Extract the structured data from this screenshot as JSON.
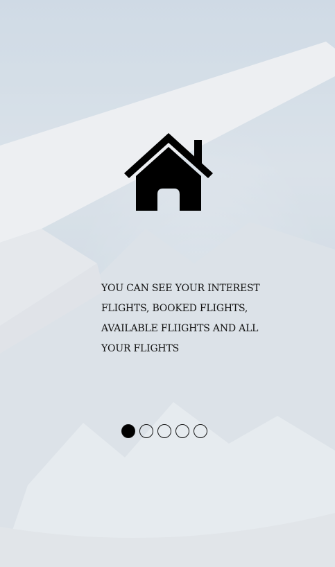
{
  "onboarding": {
    "icon": "home-icon",
    "message": "YOU CAN SEE YOUR INTEREST FLIGHTS, BOOKED FLIGHTS, AVAILABLE FLIIGHTS AND ALL YOUR FLIGHTS",
    "page_indicator": {
      "total": 5,
      "active_index": 0
    }
  }
}
